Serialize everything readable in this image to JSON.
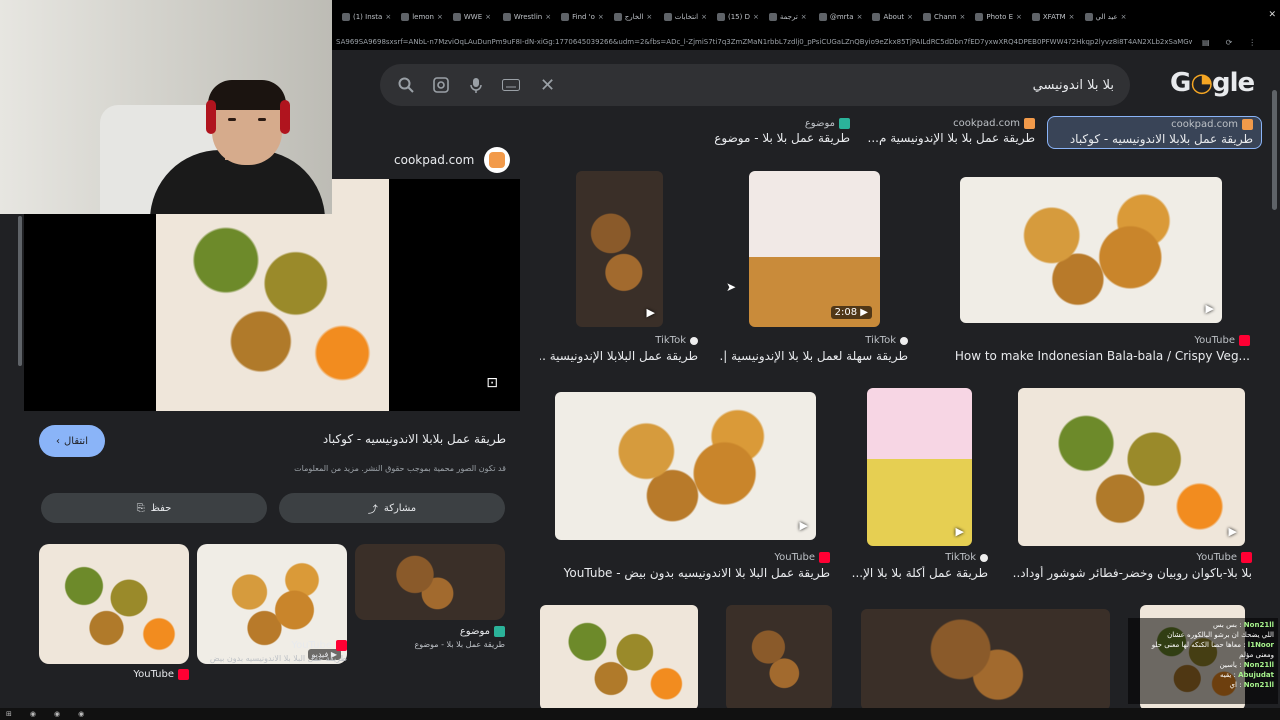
{
  "browser": {
    "tabs": [
      "(1) Insta",
      "lemon",
      "WWE",
      "Wrestlin",
      "Find 'o",
      "الخارج",
      "انتخابات",
      "(15) D",
      "ترجمة",
      "@mrta",
      "About",
      "Chann",
      "Photo E",
      "XFATM",
      "عيد الي"
    ],
    "url": "SA969SA9698sxsrf=ANbL-n7MzviOqLAuDunPm9uF8I-dN-xiGg:1770645039266&udm=2&fbs=ADc_l-ZjmiS7ti7q3ZmZMaN1rbbL7zdlj0_pPsiCUGaLZnQByio9eZkx85TjPAILdRC5dDbn7fED7yxwXRQ4DPEB0PFWW4?2Hkqp2lyvz8i8T4AN2XLb2xSaMGwLbgmYu6cWomTvfbyUjGZS..."
  },
  "search": {
    "query": "بلا بلا اندونيسي",
    "logo": "Google"
  },
  "results": {
    "top_row": [
      {
        "src": "موضوع",
        "title": "طريقة عمل بلا بلا - موضوع"
      },
      {
        "src": "cookpad.com",
        "title": "طريقة عمل بلا بلا الإندونيسية م..."
      },
      {
        "src": "cookpad.com",
        "title": "طريقة عمل بلابلا الاندونيسيه - كوكباد"
      }
    ],
    "row2": [
      {
        "src": "TikTok",
        "title": "طريقة عمل البلابلا الإندونيسية ...",
        "duration": ""
      },
      {
        "src": "TikTok",
        "title": "طريقة سهلة لعمل بلا بلا الإندونيسية |...",
        "duration": "2:08"
      },
      {
        "src": "YouTube",
        "title": "How to make Indonesian Bala-bala / Crispy Veg...",
        "duration": ""
      }
    ],
    "row3": [
      {
        "src": "YouTube",
        "title": "طريقة عمل البلا بلا الاندونيسيه بدون بيض - YouTube"
      },
      {
        "src": "TikTok",
        "title": "طريقة عمل أكلة بلا بلا الإ..."
      },
      {
        "src": "YouTube",
        "title": "بلا بلا-باكوان روبيان وخضر-فطائر شوشور أوداد..."
      }
    ]
  },
  "preview": {
    "site": "cookpad.com",
    "visit_label": "انتقال",
    "title": "طريقة عمل بلابلا الاندونيسيه - كوكباد",
    "disclaimer": "قد تكون الصور محمية بموجب حقوق النشر. مزيد من المعلومات",
    "share_label": "مشاركة",
    "save_label": "حفظ",
    "video_badge": "فيديو",
    "related": [
      {
        "src": "YouTube",
        "title": "طريقة عمل..."
      },
      {
        "src": "YouTube",
        "title": "طريقة عمل البلا بلا الاندونيسيه بدون بيض"
      },
      {
        "src": "موضوع",
        "title": "طريقة عمل بلا بلا - موضوع"
      }
    ]
  },
  "chat": [
    {
      "name": "Non21ll",
      "text": "بس بس"
    },
    {
      "name": "",
      "text": "اللي يضحك ان برشو البالكوره عشان"
    },
    {
      "name": "l1Noor",
      "text": "معاها حصا الكنكه لها معنى حلو ومعنى مؤلم"
    },
    {
      "name": "Non21ll",
      "text": "ياسين"
    },
    {
      "name": "Abujudat",
      "text": "يقيه"
    },
    {
      "name": "Non21ll",
      "text": "اي"
    }
  ],
  "colors": {
    "accent": "#8ab4f8",
    "background": "#202124",
    "surface": "#303134"
  }
}
